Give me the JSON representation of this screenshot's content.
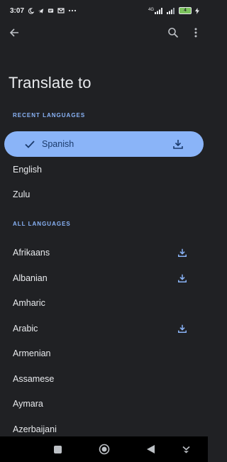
{
  "status_bar": {
    "time": "3:07",
    "network": "4G",
    "battery": "4"
  },
  "page": {
    "title": "Translate to"
  },
  "recent": {
    "label": "RECENT LANGUAGES",
    "selected": "Spanish",
    "items": [
      "English",
      "Zulu"
    ]
  },
  "all": {
    "label": "ALL LANGUAGES",
    "items": [
      {
        "name": "Afrikaans",
        "downloaded": true
      },
      {
        "name": "Albanian",
        "downloaded": true
      },
      {
        "name": "Amharic",
        "downloaded": false
      },
      {
        "name": "Arabic",
        "downloaded": true
      },
      {
        "name": "Armenian",
        "downloaded": false
      },
      {
        "name": "Assamese",
        "downloaded": false
      },
      {
        "name": "Aymara",
        "downloaded": false
      },
      {
        "name": "Azerbaijani",
        "downloaded": false
      }
    ]
  },
  "colors": {
    "background": "#202124",
    "accent": "#8ab4f8",
    "selected_text": "#1a3a6b"
  },
  "icons": {
    "back": "arrow-left-icon",
    "search": "search-icon",
    "more": "more-vertical-icon",
    "check": "check-icon",
    "download": "download-icon"
  }
}
